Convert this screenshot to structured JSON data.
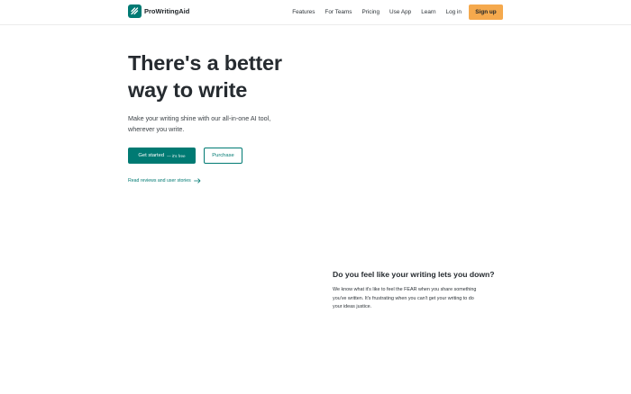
{
  "header": {
    "brand": "ProWritingAid",
    "nav": [
      "Features",
      "For Teams",
      "Pricing",
      "Use App",
      "Learn",
      "Log in"
    ],
    "signup_label": "Sign up"
  },
  "hero": {
    "title_line1": "There's a better",
    "title_line2": "way to write",
    "subtitle_line1": "Make your writing shine with our all-in-one AI tool,",
    "subtitle_line2": "wherever you write.",
    "primary_label": "Get started",
    "primary_note": "— it's free",
    "secondary_label": "Purchase",
    "reviews_link": "Read reviews and user stories"
  },
  "section": {
    "title": "Do you feel like your writing lets you down?",
    "body_line1": "We know what it's like to feel the FEAR when you share something",
    "body_line2": "you've written. It's frustrating when you can't get your writing to do",
    "body_line3": "your ideas justice."
  },
  "colors": {
    "brand": "#007a73",
    "accent": "#f5a94d",
    "text": "#262b30"
  },
  "icons": [
    "pwa-logo-icon",
    "arrow-right-icon"
  ]
}
